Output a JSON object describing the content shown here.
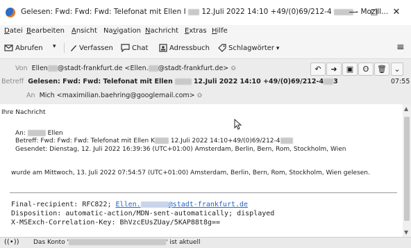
{
  "window": {
    "title_prefix": "Gelesen: Fwd: Fwd: Fwd: Telefonat mit Ellen I",
    "title_suffix": "12.Juli 2022 14:10 +49/(0)69/212-4",
    "title_app": "- Mozill...",
    "minimize": "—",
    "maximize": "☐",
    "close": "✕"
  },
  "menu": [
    {
      "first": "D",
      "rest": "atei"
    },
    {
      "first": "B",
      "rest": "earbeiten"
    },
    {
      "first": "A",
      "rest": "nsicht"
    },
    {
      "pre": "Na",
      "first": "v",
      "rest": "igation"
    },
    {
      "first": "N",
      "rest": "achricht"
    },
    {
      "first": "E",
      "rest": "xtras"
    },
    {
      "first": "H",
      "rest": "ilfe"
    }
  ],
  "toolbar": {
    "fetch": "Abrufen",
    "compose": "Verfassen",
    "chat": "Chat",
    "addressbook": "Adressbuch",
    "tags": "Schlagwörter",
    "menu_icon": "≡"
  },
  "header": {
    "from_label": "Von",
    "from_value_a": "Ellen",
    "from_value_b": "@stadt-frankfurt.de <Ellen.",
    "from_value_c": "@stadt-frankfurt.de>",
    "subject_label": "Betreff",
    "subject_a": "Gelesen: Fwd: Fwd: Telefonat mit Ellen",
    "subject_b": "12.Juli 2022 14:10 +49/(0)69/212-4",
    "subject_c": "3",
    "time": "07:55",
    "to_label": "An",
    "to_value": "Mich <maximilian.baehring@googlemail.com>"
  },
  "body": {
    "line1": "Ihre Nachricht",
    "to_label": "An:",
    "to_name": "Ellen",
    "subject_line_a": "Betreff: Fwd: Fwd: Fwd: Telefonat mit Ellen K",
    "subject_line_b": "12.Juli 2022 14:10+49/(0)69/212-4",
    "sent_line": "Gesendet: Dienstag, 12. Juli 2022 16:39:36 (UTC+01:00) Amsterdam, Berlin, Bern, Rom, Stockholm, Wien",
    "read_line": "wurde am Mittwoch, 13. Juli 2022 07:54:57 (UTC+01:00) Amsterdam, Berlin, Bern, Rom, Stockholm, Wien gelesen.",
    "mdn_recipient_label": "Final-recipient: RFC822;",
    "mdn_recipient_a": "Ellen.",
    "mdn_recipient_b": "@stadt-frankfurt.de",
    "mdn_disposition": "Disposition: automatic-action/MDN-sent-automatically; displayed",
    "mdn_correlation": "X-MSExch-Correlation-Key: BhVzcEUsZUay/5KAP88t8g=="
  },
  "status": {
    "text_a": "Das Konto '",
    "text_b": "' ist aktuell"
  }
}
